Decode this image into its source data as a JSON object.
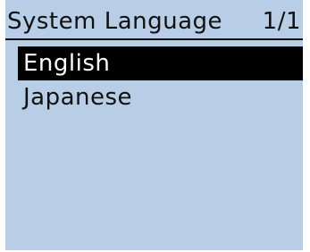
{
  "screen": {
    "title": "System Language",
    "page_indicator": "1/1",
    "background_color": "#b8cee6"
  },
  "menu": {
    "items": [
      {
        "label": "English",
        "selected": true
      },
      {
        "label": "Japanese",
        "selected": false
      }
    ],
    "selected_bg_color": "#000000",
    "selected_text_color": "#ffffff"
  }
}
